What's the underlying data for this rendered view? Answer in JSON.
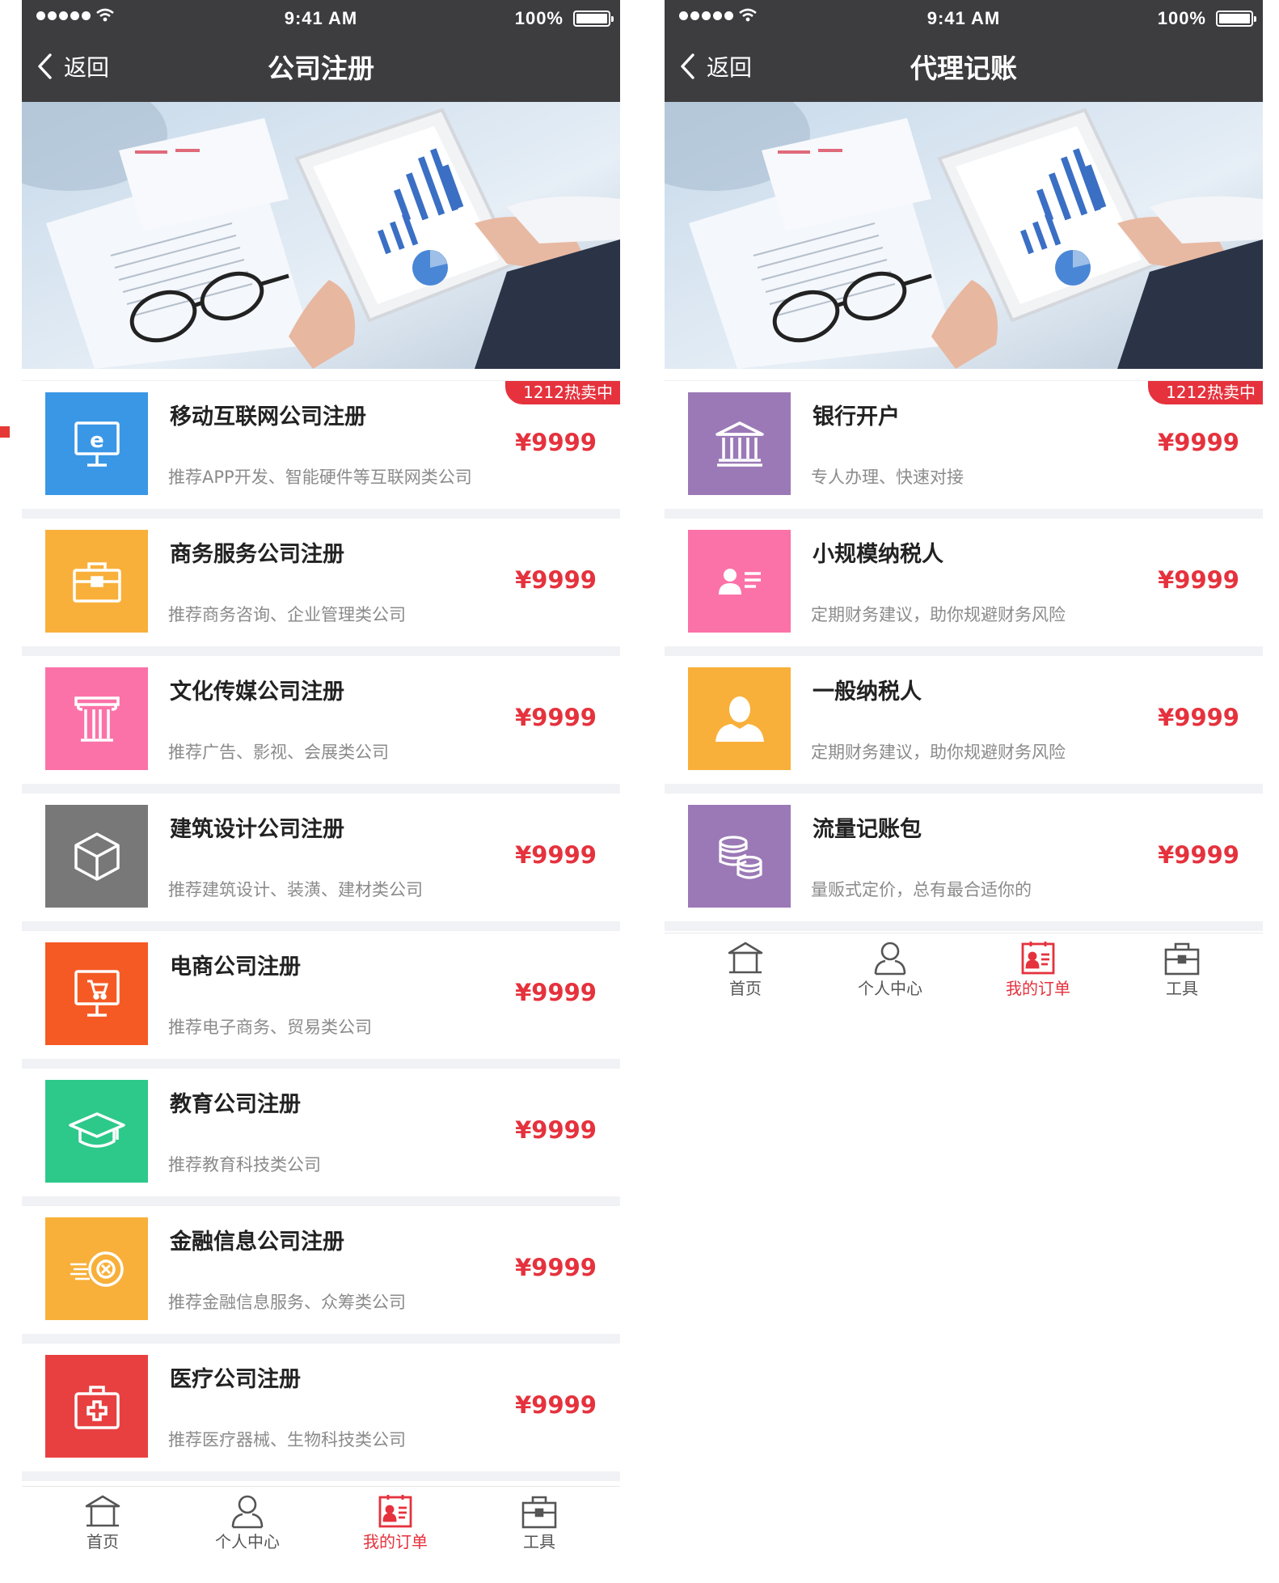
{
  "status_bar": {
    "time": "9:41 AM",
    "battery": "100%"
  },
  "left_screen": {
    "back_label": "返回",
    "title": "公司注册",
    "hot_badge": "1212热卖中",
    "items": [
      {
        "title": "移动互联网公司注册",
        "desc": "推荐APP开发、智能硬件等互联网类公司",
        "price": "¥9999",
        "icon": "internet-screen-icon",
        "color": "#3a97e6"
      },
      {
        "title": "商务服务公司注册",
        "desc": "推荐商务咨询、企业管理类公司",
        "price": "¥9999",
        "icon": "briefcase-icon",
        "color": "#f8b03a"
      },
      {
        "title": "文化传媒公司注册",
        "desc": "推荐广告、影视、会展类公司",
        "price": "¥9999",
        "icon": "column-icon",
        "color": "#fb72a8"
      },
      {
        "title": "建筑设计公司注册",
        "desc": "推荐建筑设计、装潢、建材类公司",
        "price": "¥9999",
        "icon": "cube-icon",
        "color": "#787878"
      },
      {
        "title": "电商公司注册",
        "desc": "推荐电子商务、贸易类公司",
        "price": "¥9999",
        "icon": "shopping-cart-board-icon",
        "color": "#f55a24"
      },
      {
        "title": "教育公司注册",
        "desc": "推荐教育科技类公司",
        "price": "¥9999",
        "icon": "graduation-cap-icon",
        "color": "#2dc98a"
      },
      {
        "title": "金融信息公司注册",
        "desc": "推荐金融信息服务、众筹类公司",
        "price": "¥9999",
        "icon": "coin-icon",
        "color": "#f8b03a"
      },
      {
        "title": "医疗公司注册",
        "desc": "推荐医疗器械、生物科技类公司",
        "price": "¥9999",
        "icon": "medical-kit-icon",
        "color": "#e84040"
      }
    ]
  },
  "right_screen": {
    "back_label": "返回",
    "title": "代理记账",
    "hot_badge": "1212热卖中",
    "items": [
      {
        "title": "银行开户",
        "desc": "专人办理、快速对接",
        "price": "¥9999",
        "icon": "bank-icon",
        "color": "#9b79b6"
      },
      {
        "title": "小规模纳税人",
        "desc": "定期财务建议，助你规避财务风险",
        "price": "¥9999",
        "icon": "id-card-icon",
        "color": "#fb72a8"
      },
      {
        "title": "一般纳税人",
        "desc": "定期财务建议，助你规避财务风险",
        "price": "¥9999",
        "icon": "user-icon",
        "color": "#f8b03a"
      },
      {
        "title": "流量记账包",
        "desc": "量贩式定价，总有最合适你的",
        "price": "¥9999",
        "icon": "coin-stack-icon",
        "color": "#9b79b6"
      }
    ]
  },
  "tabbar": {
    "home": "首页",
    "profile": "个人中心",
    "orders": "我的订单",
    "tools": "工具",
    "active_tab": "orders",
    "active_color": "#e5323d"
  }
}
